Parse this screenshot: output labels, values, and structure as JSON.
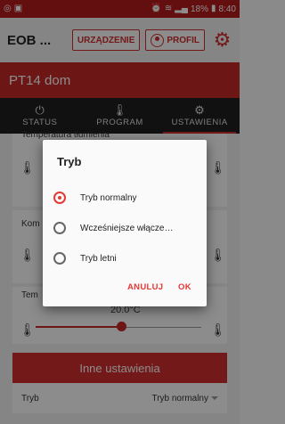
{
  "status_bar": {
    "left_icons": [
      "ring-icon",
      "gallery-icon"
    ],
    "right_text": "18%",
    "time": "8:40"
  },
  "app_bar": {
    "title": "EOB ...",
    "device_button": "URZĄDZENIE",
    "profile_button": "PROFIL"
  },
  "device_bar": {
    "name": "PT14 dom"
  },
  "tabs": [
    {
      "label": "STATUS",
      "icon": "power-icon"
    },
    {
      "label": "PROGRAM",
      "icon": "thermometer-icon"
    },
    {
      "label": "USTAWIENIA",
      "icon": "gear-icon"
    }
  ],
  "background": {
    "row1_label": "Temperatura tłumienia",
    "row2_label": "Kom",
    "row3_label": "Tem",
    "row3_value": "20.0°C",
    "row3_slider_fraction": 0.52,
    "section_title": "Inne ustawienia",
    "tryb_label": "Tryb",
    "tryb_value": "Tryb normalny"
  },
  "dialog": {
    "title": "Tryb",
    "options": [
      {
        "label": "Tryb normalny",
        "selected": true
      },
      {
        "label": "Wcześniejsze włącze…",
        "selected": false
      },
      {
        "label": "Tryb letni",
        "selected": false
      }
    ],
    "cancel": "ANULUJ",
    "ok": "OK"
  },
  "colors": {
    "accent": "#d32f2f",
    "tabbar": "#1f1f1f"
  }
}
